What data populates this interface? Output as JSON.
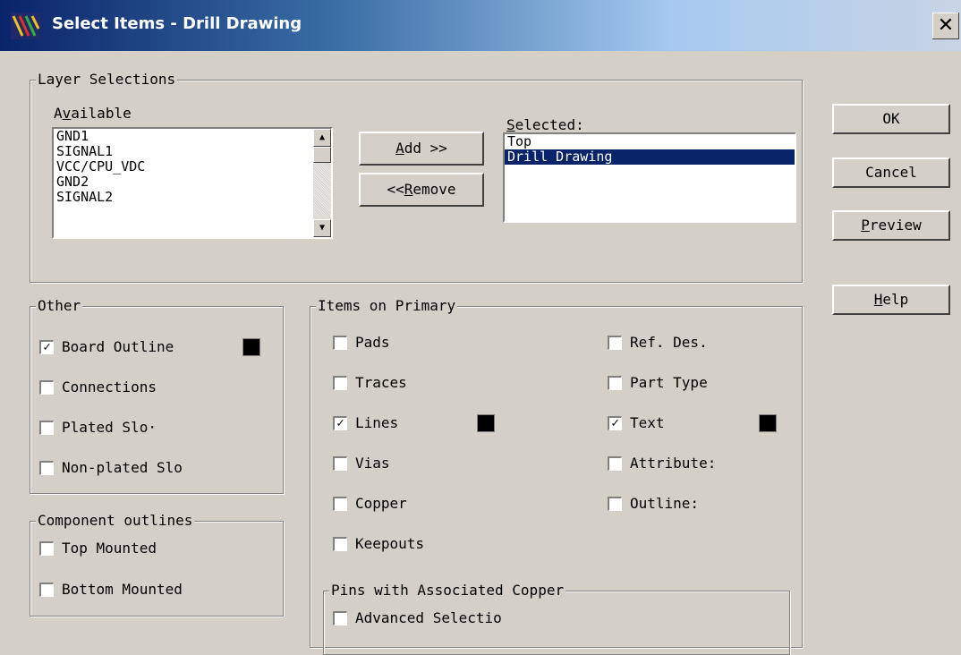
{
  "window": {
    "title": "Select Items - Drill Drawing",
    "close_glyph": "✕"
  },
  "layer_selections": {
    "legend": "Layer Selections",
    "available": {
      "label_pre": "A",
      "label_mnemonic": "v",
      "label_post": "ailable",
      "items": [
        "GND1",
        "SIGNAL1",
        "VCC/CPU_VDC",
        "GND2",
        "SIGNAL2"
      ]
    },
    "selected": {
      "label_mnemonic": "S",
      "label_post": "elected:",
      "items": [
        "Top",
        "Drill Drawing"
      ],
      "highlighted_index": 1
    },
    "add_button": {
      "mnemonic": "A",
      "rest": "dd >>"
    },
    "remove_button": {
      "pre": "<<",
      "mnemonic": "R",
      "rest": "emove"
    }
  },
  "other": {
    "legend": "Other",
    "items": [
      {
        "label": "Board Outline",
        "checked": true,
        "swatch": "#000000"
      },
      {
        "label": "Connections",
        "checked": false
      },
      {
        "label": "Plated Slo·",
        "checked": false
      },
      {
        "label": "Non-plated Slo",
        "checked": false
      }
    ]
  },
  "component_outlines": {
    "legend": "Component outlines",
    "items": [
      {
        "label": "Top Mounted",
        "checked": false
      },
      {
        "label": "Bottom Mounted",
        "checked": false
      }
    ]
  },
  "items_on_primary": {
    "legend": "Items on Primary",
    "left": [
      {
        "label": "Pads",
        "checked": false
      },
      {
        "label": "Traces",
        "checked": false
      },
      {
        "label": "Lines",
        "checked": true,
        "swatch": "#000000"
      },
      {
        "label": "Vias",
        "checked": false
      },
      {
        "label": "Copper",
        "checked": false
      },
      {
        "label": "Keepouts",
        "checked": false
      }
    ],
    "right": [
      {
        "label": "Ref. Des.",
        "checked": false
      },
      {
        "label": "Part Type",
        "checked": false
      },
      {
        "label": "Text",
        "checked": true,
        "swatch": "#000000"
      },
      {
        "label": "Attribute:",
        "checked": false
      },
      {
        "label": "Outline:",
        "checked": false
      }
    ],
    "pins": {
      "legend": "Pins with Associated Copper",
      "items": [
        {
          "label": "Advanced Selectio",
          "checked": false
        }
      ]
    }
  },
  "buttons": {
    "ok": "OK",
    "cancel": "Cancel",
    "preview": {
      "mnemonic": "P",
      "rest": "review"
    },
    "help": {
      "mnemonic": "H",
      "rest": "elp"
    }
  },
  "check_glyph": "✓"
}
